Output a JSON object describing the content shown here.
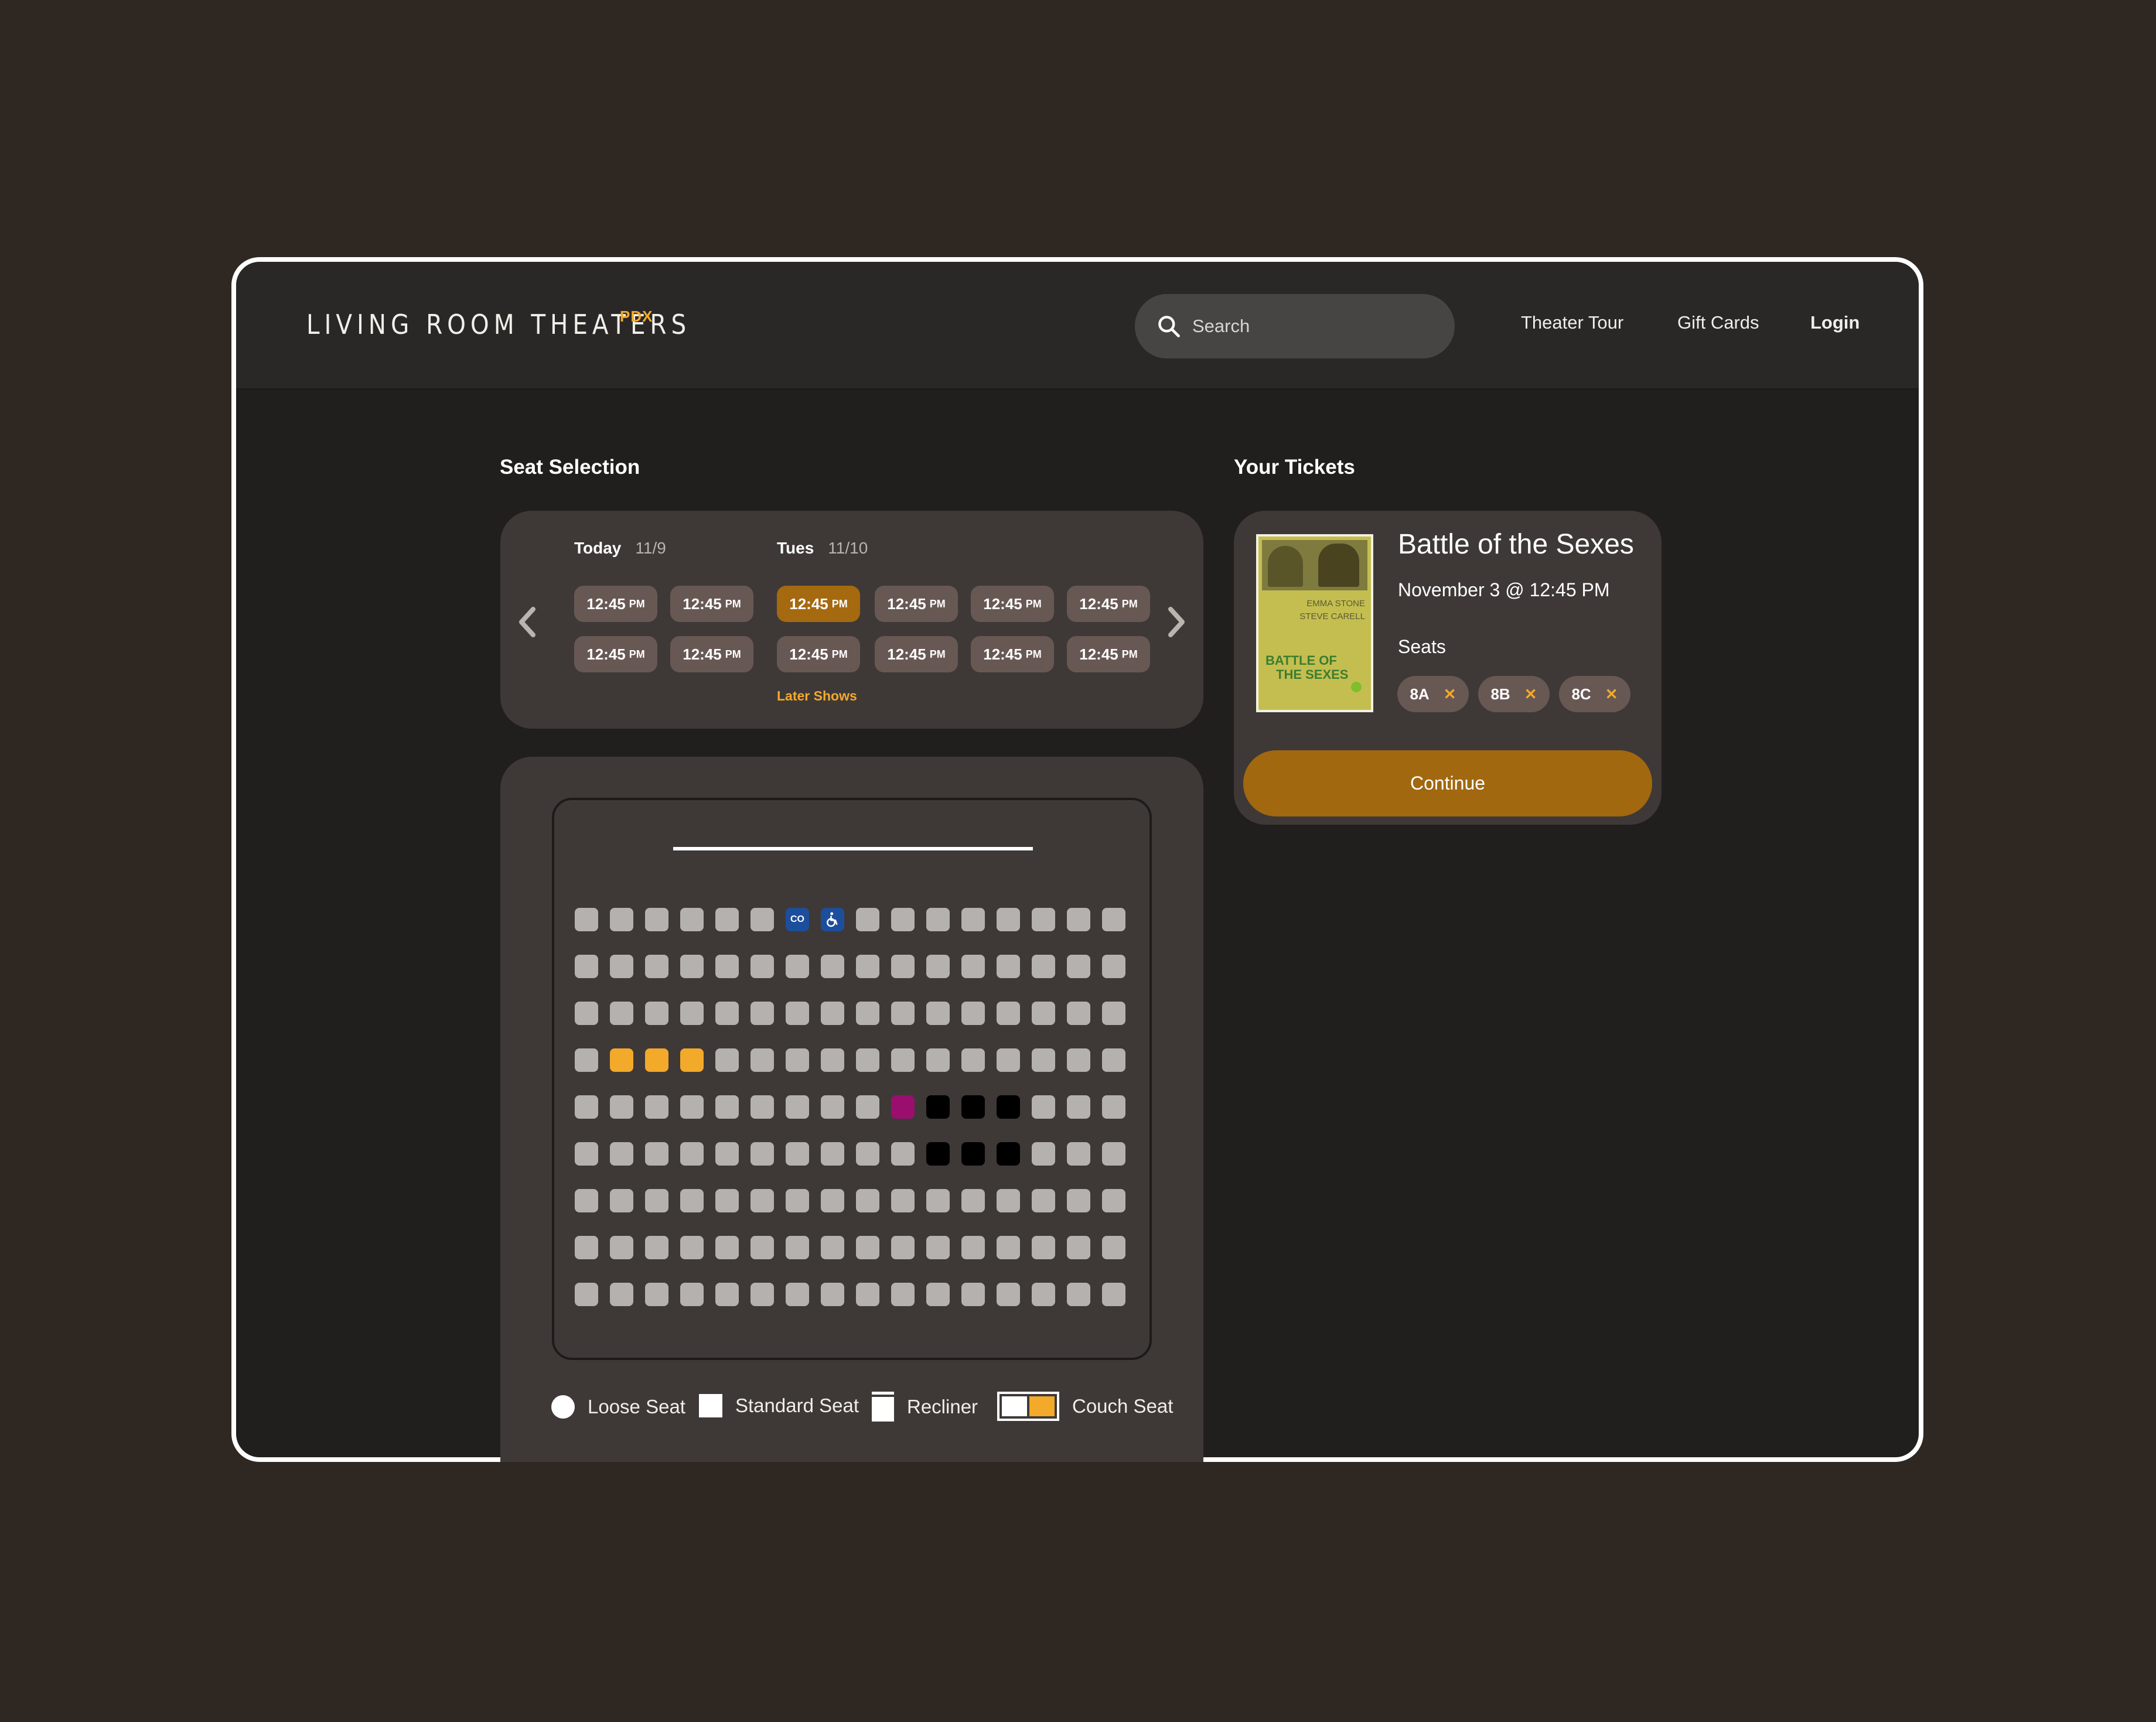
{
  "header": {
    "logo": "LIVING ROOM THEATERS",
    "logo_sup": "PDX",
    "search_placeholder": "Search",
    "nav": [
      "Theater Tour",
      "Gift Cards",
      "Login"
    ]
  },
  "seat_selection": {
    "title": "Seat Selection",
    "days": [
      {
        "label": "Today",
        "date": "11/9"
      },
      {
        "label": "Tues",
        "date": "11/10"
      }
    ],
    "times": {
      "time": "12:45",
      "suffix": "PM"
    },
    "selected_time_index": 2,
    "later_shows": "Later Shows",
    "seat_grid": {
      "rows": 9,
      "cols": 16,
      "special": {
        "co": {
          "row": 0,
          "col": 6,
          "label": "CO"
        },
        "wheelchair": {
          "row": 0,
          "col": 7
        },
        "selected": [
          [
            3,
            1
          ],
          [
            3,
            2
          ],
          [
            3,
            3
          ]
        ],
        "highlight": [
          [
            4,
            9
          ]
        ],
        "unavailable": [
          [
            4,
            10
          ],
          [
            4,
            11
          ],
          [
            4,
            12
          ],
          [
            5,
            10
          ],
          [
            5,
            11
          ],
          [
            5,
            12
          ]
        ]
      }
    },
    "legend": [
      "Loose Seat",
      "Standard Seat",
      "Recliner",
      "Couch Seat"
    ]
  },
  "tickets": {
    "title": "Your Tickets",
    "movie_title": "Battle of the Sexes",
    "showing": "November 3 @ 12:45 PM",
    "seats_label": "Seats",
    "seats": [
      "8A",
      "8B",
      "8C"
    ],
    "continue_label": "Continue",
    "poster": {
      "names_line1": "EMMA STONE",
      "names_line2": "STEVE CARELL",
      "title_line1": "BATTLE OF",
      "title_line2": "THE SEXES"
    }
  },
  "colors": {
    "accent": "#f3a929",
    "button": "#a1680f",
    "selected_time": "#a5690f",
    "unavailable": "#000000",
    "highlight": "#9a0e6e",
    "accessible": "#1c4e9c"
  },
  "icons": [
    "search-icon",
    "chevron-left-icon",
    "chevron-right-icon",
    "wheelchair-icon",
    "close-icon"
  ]
}
